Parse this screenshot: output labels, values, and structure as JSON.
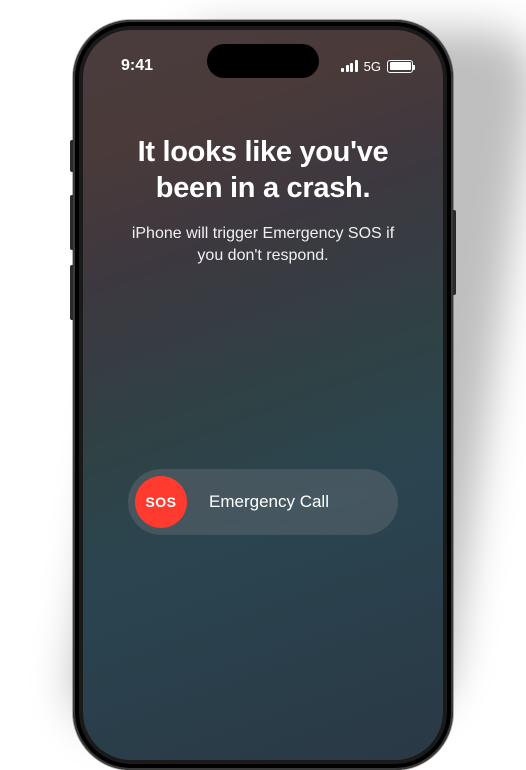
{
  "statusBar": {
    "time": "9:41",
    "networkLabel": "5G"
  },
  "crashAlert": {
    "headline": "It looks like you've been in a crash.",
    "subtext": "iPhone will trigger Emergency SOS if you don't respond."
  },
  "slider": {
    "knobLabel": "SOS",
    "trackLabel": "Emergency Call"
  },
  "colors": {
    "sosRed": "#ff3b30"
  }
}
